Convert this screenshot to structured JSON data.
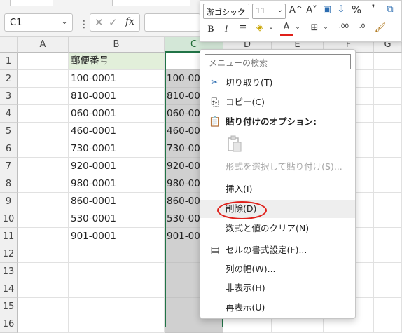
{
  "name_box": {
    "value": "C1"
  },
  "formula_bar": {
    "fx": "fx"
  },
  "mini_toolbar": {
    "font_name": "游ゴシック",
    "font_size": "11",
    "grow_font": "A^",
    "shrink_font": "A˅",
    "percent": "%",
    "comma": "❜",
    "bold": "B",
    "italic": "I",
    "align": "≡",
    "font_color_letter": "A",
    "inc_decimal": ".00",
    "dec_decimal": ".0"
  },
  "columns": [
    "A",
    "B",
    "C",
    "D",
    "E",
    "F",
    "G"
  ],
  "rows": [
    "1",
    "2",
    "3",
    "4",
    "5",
    "6",
    "7",
    "8",
    "9",
    "10",
    "11",
    "12",
    "13",
    "14",
    "15",
    "16"
  ],
  "sheet": {
    "b_header": "郵便番号",
    "b_values": [
      "100-0001",
      "810-0001",
      "060-0001",
      "460-0001",
      "730-0001",
      "920-0001",
      "980-0001",
      "860-0001",
      "530-0001",
      "901-0001"
    ],
    "c_values": [
      "100-00",
      "810-00",
      "060-00",
      "460-00",
      "730-00",
      "920-00",
      "980-00",
      "860-00",
      "530-00",
      "901-00"
    ]
  },
  "context_menu": {
    "search_placeholder": "メニューの検索",
    "cut": "切り取り(T)",
    "copy": "コピー(C)",
    "paste_options": "貼り付けのオプション:",
    "paste_special": "形式を選択して貼り付け(S)...",
    "insert": "挿入(I)",
    "delete": "削除(D)",
    "clear_contents": "数式と値のクリア(N)",
    "format_cells": "セルの書式設定(F)...",
    "column_width": "列の幅(W)...",
    "hide": "非表示(H)",
    "unhide": "再表示(U)"
  },
  "colors": {
    "selected_header": "#d3e7d7",
    "accent_green": "#217346",
    "header_fill": "#e2efda",
    "annotation_red": "#e0201a",
    "font_color_red": "#e0201a"
  }
}
